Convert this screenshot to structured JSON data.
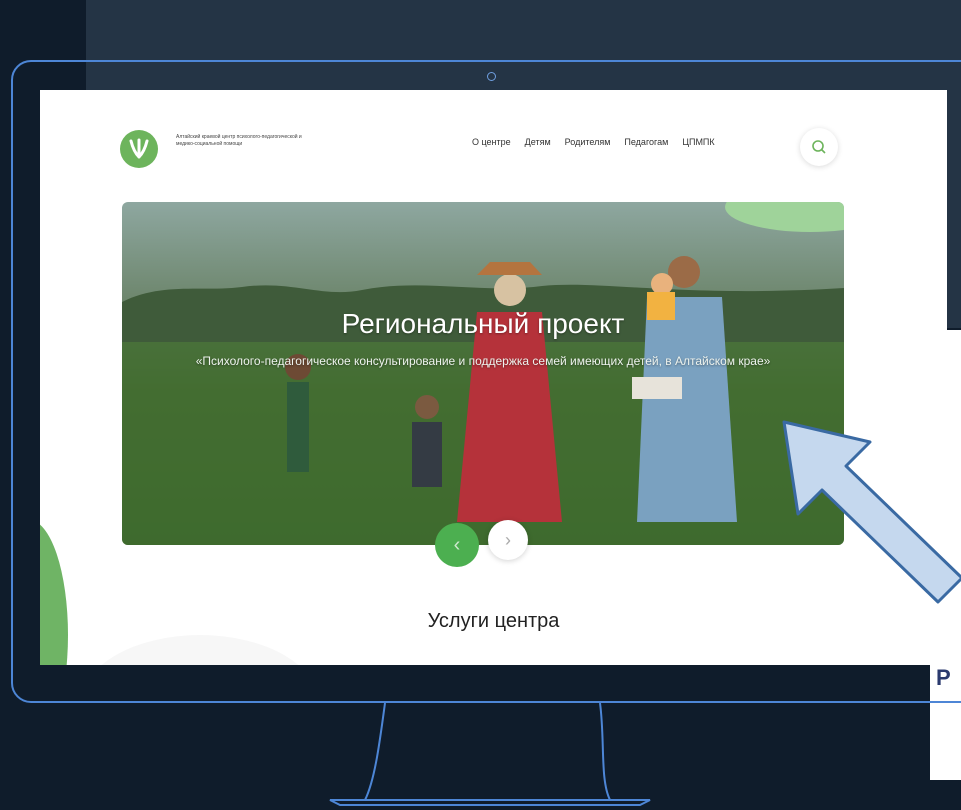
{
  "logo_text": "Алтайский краевой центр психолого-педагогической и медико-социальной помощи",
  "nav": {
    "items": [
      "О центре",
      "Детям",
      "Родителям",
      "Педагогам",
      "ЦПМПК"
    ]
  },
  "hero": {
    "title": "Региональный проект",
    "subtitle": "«Психолого-педагогическое консультирование и поддержка семей имеющих детей, в Алтайском крае»"
  },
  "carousel": {
    "prev_icon": "chevron-left-icon",
    "next_icon": "chevron-right-icon"
  },
  "sections": {
    "services_title": "Услуги центра"
  },
  "side_panel_text": "Р",
  "colors": {
    "brand_green": "#4caf50",
    "accent_blue": "#4d86d6",
    "arrow_fill": "#c5d8ee",
    "arrow_stroke": "#3a6aa3"
  }
}
